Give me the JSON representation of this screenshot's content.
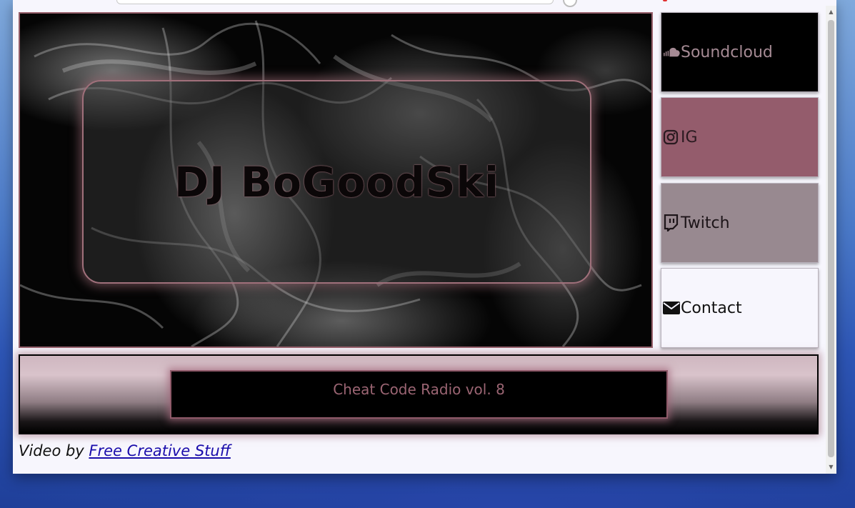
{
  "hero": {
    "title": "DJ BoGoodSki"
  },
  "nav": {
    "items": [
      {
        "label": "Soundcloud",
        "icon": "soundcloud-icon"
      },
      {
        "label": "IG",
        "icon": "instagram-icon"
      },
      {
        "label": "Twitch",
        "icon": "twitch-icon"
      },
      {
        "label": "Contact",
        "icon": "envelope-icon"
      }
    ]
  },
  "player": {
    "track_title": "Cheat Code Radio vol. 8"
  },
  "footer": {
    "credit_prefix": "Video by ",
    "credit_link": "Free Creative Stuff"
  },
  "colors": {
    "accent": "#945c6c",
    "mauve": "#988990",
    "border": "#97606b"
  }
}
